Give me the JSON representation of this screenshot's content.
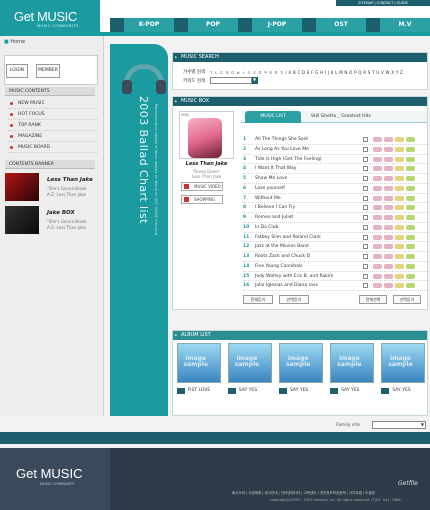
{
  "brand": {
    "name": "Get MUSIC",
    "tagline": "MUSIC COMMUNITY"
  },
  "util_links": [
    "SITEMAP",
    "CONTACT",
    "GUIDE"
  ],
  "nav": [
    "K-POP",
    "POP",
    "J-POP",
    "OST",
    "M.V"
  ],
  "breadcrumb": "Home",
  "auth": {
    "login": "LOGIN",
    "member": "MEMBER"
  },
  "contents": {
    "title": "MUSIC CONTENTS",
    "items": [
      "NEW MUSIC",
      "HOT FOCUS",
      "TOP RANK",
      "MAGAZINE",
      "MUSIC BOARD"
    ]
  },
  "banner": {
    "title": "CONTENTS BANNER",
    "items": [
      {
        "title": "Less Than Jake",
        "line1": "\"She's Gonna Break",
        "line2": "A-Z: Less Than Jake"
      },
      {
        "title": "Jake BOX",
        "line1": "\"She's Gonna Break",
        "line2": "A-Z: Less Than Jake"
      }
    ]
  },
  "vertical": {
    "title": "2003 Ballad Chart list",
    "sub": "Representative playlist of music wallets en album on OST, MUSIC including"
  },
  "search": {
    "title": "MUSIC SEARCH",
    "label1": "가수별 검색",
    "alphabet": "ㄱ ㄴ ㄷ ㄹ ㅁ ㅂ ㅅ ㅇ ㅈ ㅊ ㅋ ㅌ ㅍ ㅎ / A B C D E F G H I J K L M N O P Q R S T U V W X Y Z",
    "label2": "키워드 검색",
    "select_value": ""
  },
  "musicbox": {
    "title": "MUSIC BOX",
    "cover_tag": "VOD",
    "album_title": "Less Than Jake",
    "album_sub1": "\"Break Down\"",
    "album_sub2": "Less Than Jake",
    "btn_video": "MUSIC VIDEO",
    "btn_shopping": "SHOPPING",
    "tab_active": "MUSIC LIST",
    "tab_album": "Still Ghetto _ Greatest Hits",
    "tracks": [
      {
        "n": "1",
        "t": "All The Things She Said"
      },
      {
        "n": "2",
        "t": "As Long As You Love Me"
      },
      {
        "n": "3",
        "t": "Tide Is High (Get The Feeling)"
      },
      {
        "n": "4",
        "t": "I Want It That Way"
      },
      {
        "n": "5",
        "t": "Show Me Love"
      },
      {
        "n": "6",
        "t": "Lose yourself"
      },
      {
        "n": "7",
        "t": "Without Me"
      },
      {
        "n": "8",
        "t": "I Believe I Can Fly"
      },
      {
        "n": "9",
        "t": "Romeo and Juliet"
      },
      {
        "n": "10",
        "t": "In Da Club"
      },
      {
        "n": "11",
        "t": "Fatboy Slim and Roland Clark"
      },
      {
        "n": "12",
        "t": "Jazz at the Movies Band"
      },
      {
        "n": "13",
        "t": "Roots Zack and Chuck D"
      },
      {
        "n": "14",
        "t": "Fine Young Cannibals"
      },
      {
        "n": "15",
        "t": "Jody Watley with Eric B. and Rakim"
      },
      {
        "n": "16",
        "t": "Julio Iglesias and Diana ross"
      }
    ],
    "buttons": [
      "전체듣기",
      "선택듣기",
      "전체선택",
      "선택듣기"
    ]
  },
  "album_list": {
    "title": "ALBUM LIST",
    "items": [
      "FIST LOVE",
      "SAY YES",
      "SAY YES",
      "SAY YES",
      "SAY YES"
    ]
  },
  "family": {
    "label": "Family site"
  },
  "footer": {
    "getfile": "Getfile",
    "links": "회사소개 | 사업제휴 | 광고안내 | 인터넷에디터 | 고객센터 | 개인정보보호정책 | 사이트맵 | 도움말",
    "copyright": "copyright(c)2003 - 2003 cfsmind, inc. All rights reserved. (T)02. 541. 7488"
  }
}
